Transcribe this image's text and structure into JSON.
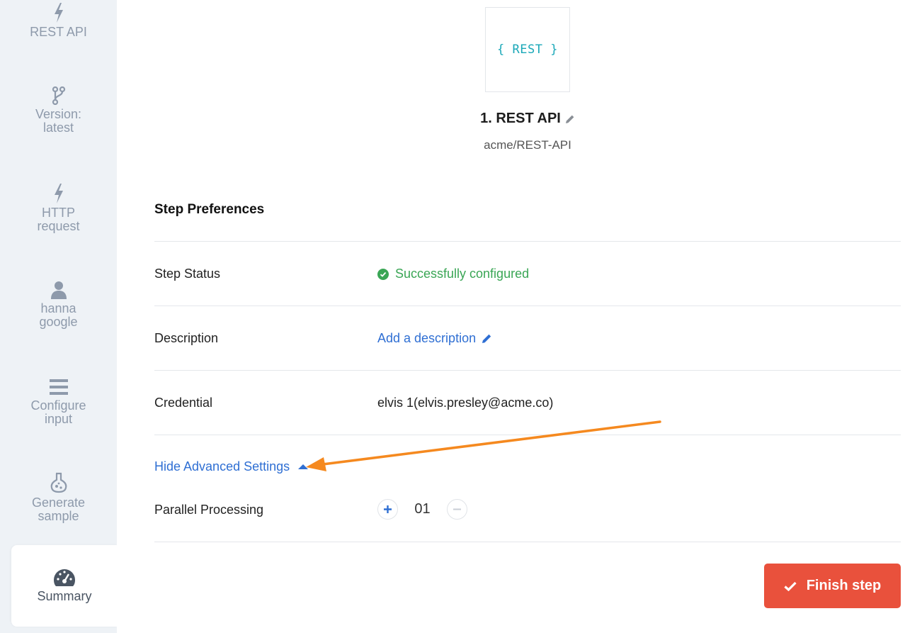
{
  "sidebar": {
    "items": [
      {
        "label": "REST API",
        "icon": "bolt-icon"
      },
      {
        "label_line1": "Version:",
        "label_line2": "latest",
        "icon": "branch-icon"
      },
      {
        "label_line1": "HTTP",
        "label_line2": "request",
        "icon": "bolt-icon"
      },
      {
        "label_line1": "hanna",
        "label_line2": "google",
        "icon": "user-icon"
      },
      {
        "label_line1": "Configure",
        "label_line2": "input",
        "icon": "menu-icon"
      },
      {
        "label_line1": "Generate",
        "label_line2": "sample",
        "icon": "flask-icon"
      },
      {
        "label": "Summary",
        "icon": "dashboard-icon",
        "active": true
      }
    ]
  },
  "app": {
    "logo_text": "{ REST }",
    "title": "1. REST API",
    "subtitle": "acme/REST-API"
  },
  "preferences": {
    "title": "Step Preferences",
    "status_label": "Step Status",
    "status_value": "Successfully configured",
    "description_label": "Description",
    "description_link": "Add a description",
    "credential_label": "Credential",
    "credential_value": "elvis 1(elvis.presley@acme.co)",
    "advanced_toggle": "Hide Advanced Settings",
    "parallel_label": "Parallel Processing",
    "parallel_value": "01"
  },
  "actions": {
    "finish_label": "Finish step"
  },
  "colors": {
    "accent": "#2f6fd3",
    "success": "#3aa655",
    "finish": "#e9513c",
    "annotation_arrow": "#f5891f",
    "sidebar_bg": "#eef2f6"
  }
}
